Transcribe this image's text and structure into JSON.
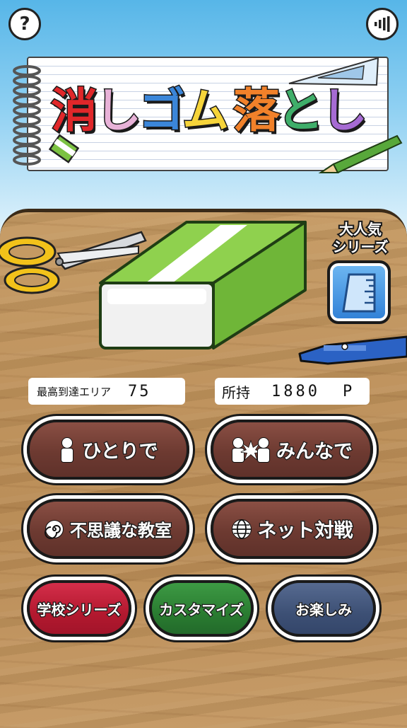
{
  "header": {
    "help_label": "?",
    "help_icon": "question-mark-icon",
    "sound_icon": "sound-icon"
  },
  "logo": {
    "chars": [
      "消",
      "し",
      "ゴ",
      "ム",
      "落",
      "と",
      "し"
    ],
    "colors": [
      "#e0272a",
      "#e8b2d8",
      "#3b86d9",
      "#f6d43a",
      "#f1812a",
      "#3fae6a",
      "#a66bd3"
    ]
  },
  "featured": {
    "label_line1": "大人気",
    "label_line2": "シリーズ",
    "icon": "ruler-icon"
  },
  "stats": {
    "best_area_label": "最高到達エリア",
    "best_area_value": "75",
    "points_label": "所持",
    "points_value": "1880",
    "points_unit": "P"
  },
  "menu": {
    "solo": "ひとりで",
    "multi": "みんなで",
    "mystery": "不思議な教室",
    "online": "ネット対戦",
    "school": "学校シリーズ",
    "customize": "カスタマイズ",
    "fun": "お楽しみ"
  },
  "colors": {
    "brown_button": "#6d3a31",
    "red_button": "#b3192f",
    "green_button": "#2a7c31",
    "navy_button": "#3d5075",
    "eraser_green": "#7cc242"
  }
}
